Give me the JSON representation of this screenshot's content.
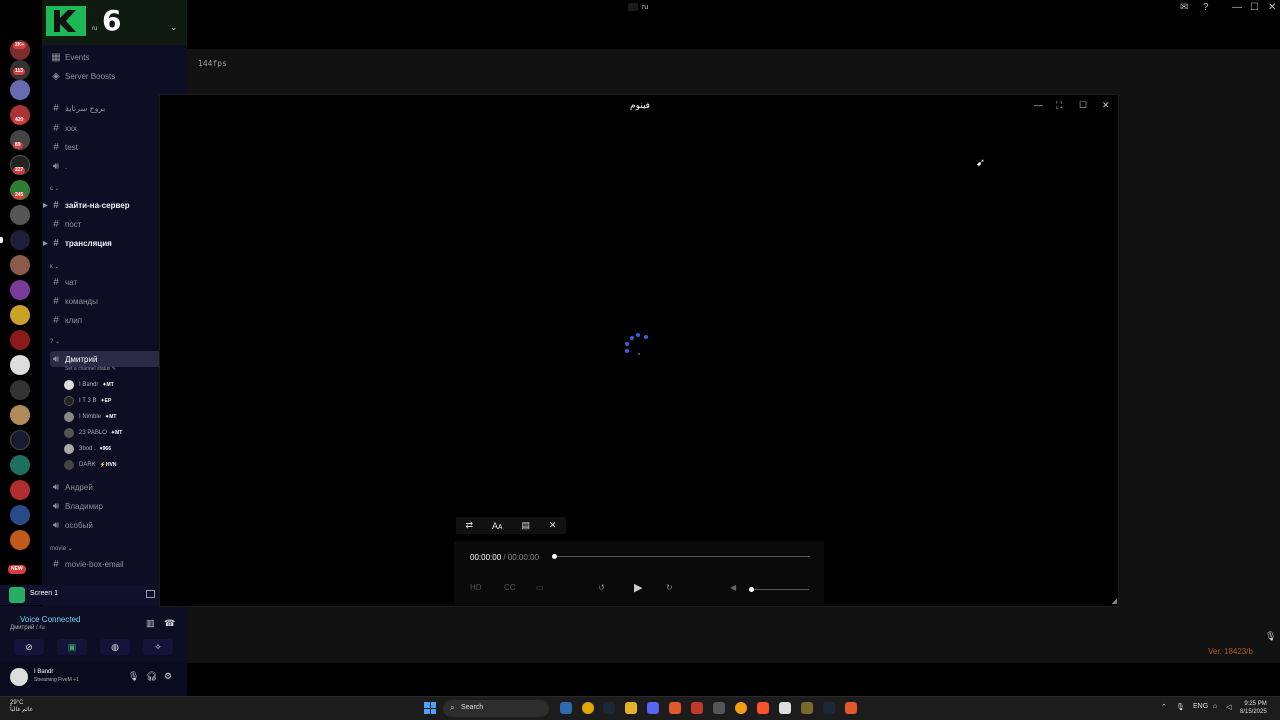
{
  "window": {
    "title": "ru"
  },
  "server": {
    "name": "ru",
    "logo_text": "6"
  },
  "rail": {
    "badges": [
      "2K+",
      "113",
      "420",
      "89",
      "227",
      "245",
      "NEW"
    ]
  },
  "channels": {
    "events": "Events",
    "boosts": "Server Boosts",
    "c1": "بروح سرتاية",
    "c2": "xxx",
    "c3": "test",
    "c4": ".",
    "cat1": "с ⌄",
    "c5": "зайти-на-сервер",
    "c6": "пост",
    "c7": "трансляция",
    "cat2": "к ⌄",
    "c8": "чат",
    "c9": "команды",
    "c10": "клип",
    "cat3": "? ⌄",
    "voice_active": "Дмитрий",
    "status_prompt": "Set a channel status ✎",
    "voice2": "Андрей",
    "voice3": "Владимир",
    "voice4": "особый",
    "cat4": "movie ⌄",
    "c11": "movie-box-email"
  },
  "voice_users": [
    {
      "name": "I Bandr",
      "tag": "✦MT"
    },
    {
      "name": "I T 3 B",
      "tag": "✦EP"
    },
    {
      "name": "I Nimble",
      "tag": "✦MT"
    },
    {
      "name": "23 PABLO",
      "tag": "✦MT"
    },
    {
      "name": "3bod .",
      "tag": "♥966"
    },
    {
      "name": "DARK",
      "tag": "⚡HVN"
    }
  ],
  "screenshare": {
    "label": "Screen 1"
  },
  "voice_status": {
    "title": "Voice Connected",
    "subtitle": "Дмитрий / ru"
  },
  "user": {
    "name": "I Bandr",
    "status": "Streaming FiveM +1"
  },
  "main": {
    "fps": "144fps",
    "version": "Ver. 18423/b"
  },
  "popup": {
    "title": "فينوم",
    "time_current": "00:00:00",
    "time_sep": " / ",
    "time_total": "00:00:00",
    "progress": 0,
    "volume": 0
  },
  "taskbar": {
    "weather_temp": "29°C",
    "weather_desc": "غائم غالباً",
    "search": "Search",
    "lang": "ENG",
    "time": "9:25 PM",
    "date": "8/15/2025"
  }
}
